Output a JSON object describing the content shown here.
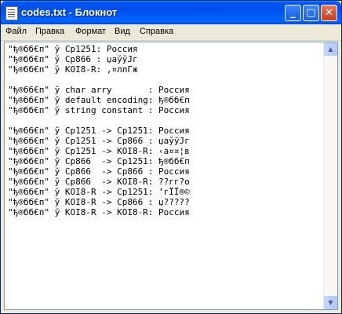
{
  "window": {
    "title": "codes.txt - Блокнот",
    "minimize_glyph": "_",
    "maximize_glyph": "□",
    "close_glyph": "✕"
  },
  "menu": {
    "items": [
      {
        "label": "Файл"
      },
      {
        "label": "Правка"
      },
      {
        "label": "Формат"
      },
      {
        "label": "Вид"
      },
      {
        "label": "Справка"
      }
    ]
  },
  "document": {
    "lines": [
      "\"ђ®бб€п\" ў Cp1251: Россия",
      "\"ђ®бб€п\" ў Cp866 : џаўўЈг",
      "\"ђ®бб€п\" ў KOI8-R: ‚¤ллГж",
      "",
      "\"ђ®бб€п\" ў char arry       : Россия",
      "\"ђ®бб€п\" ў default encoding: ђ®бб€п",
      "\"ђ®бб€п\" ў string constant : Россия",
      "",
      "\"ђ®бб€п\" ў Cp1251 -> Cp1251: Россия",
      "\"ђ®бб€п\" ў Cp1251 -> Cp866 : џаўўЈг",
      "\"ђ®бб€п\" ў Cp1251 -> KOI8-R: ‹а¤¤¦в",
      "\"ђ®бб€п\" ў Cp866  -> Cp1251: ђ®бб€п",
      "\"ђ®бб€п\" ў Cp866  -> Cp866 : Россия",
      "\"ђ®бб€п\" ў Cp866  -> KOI8-R: ??гг?о",
      "\"ђ®бб€п\" ў KOI8-R -> Cp1251: ’гЇЇ®©",
      "\"ђ®бб€п\" ў KOI8-R -> Cp866 : џ?????",
      "\"ђ®бб€п\" ў KOI8-R -> KOI8-R: Россия"
    ]
  },
  "scrollbar": {
    "up_glyph": "▲",
    "down_glyph": "▼"
  },
  "colors": {
    "titlebar": "#0054e3",
    "close_button": "#d3522e",
    "text": "#000000"
  }
}
